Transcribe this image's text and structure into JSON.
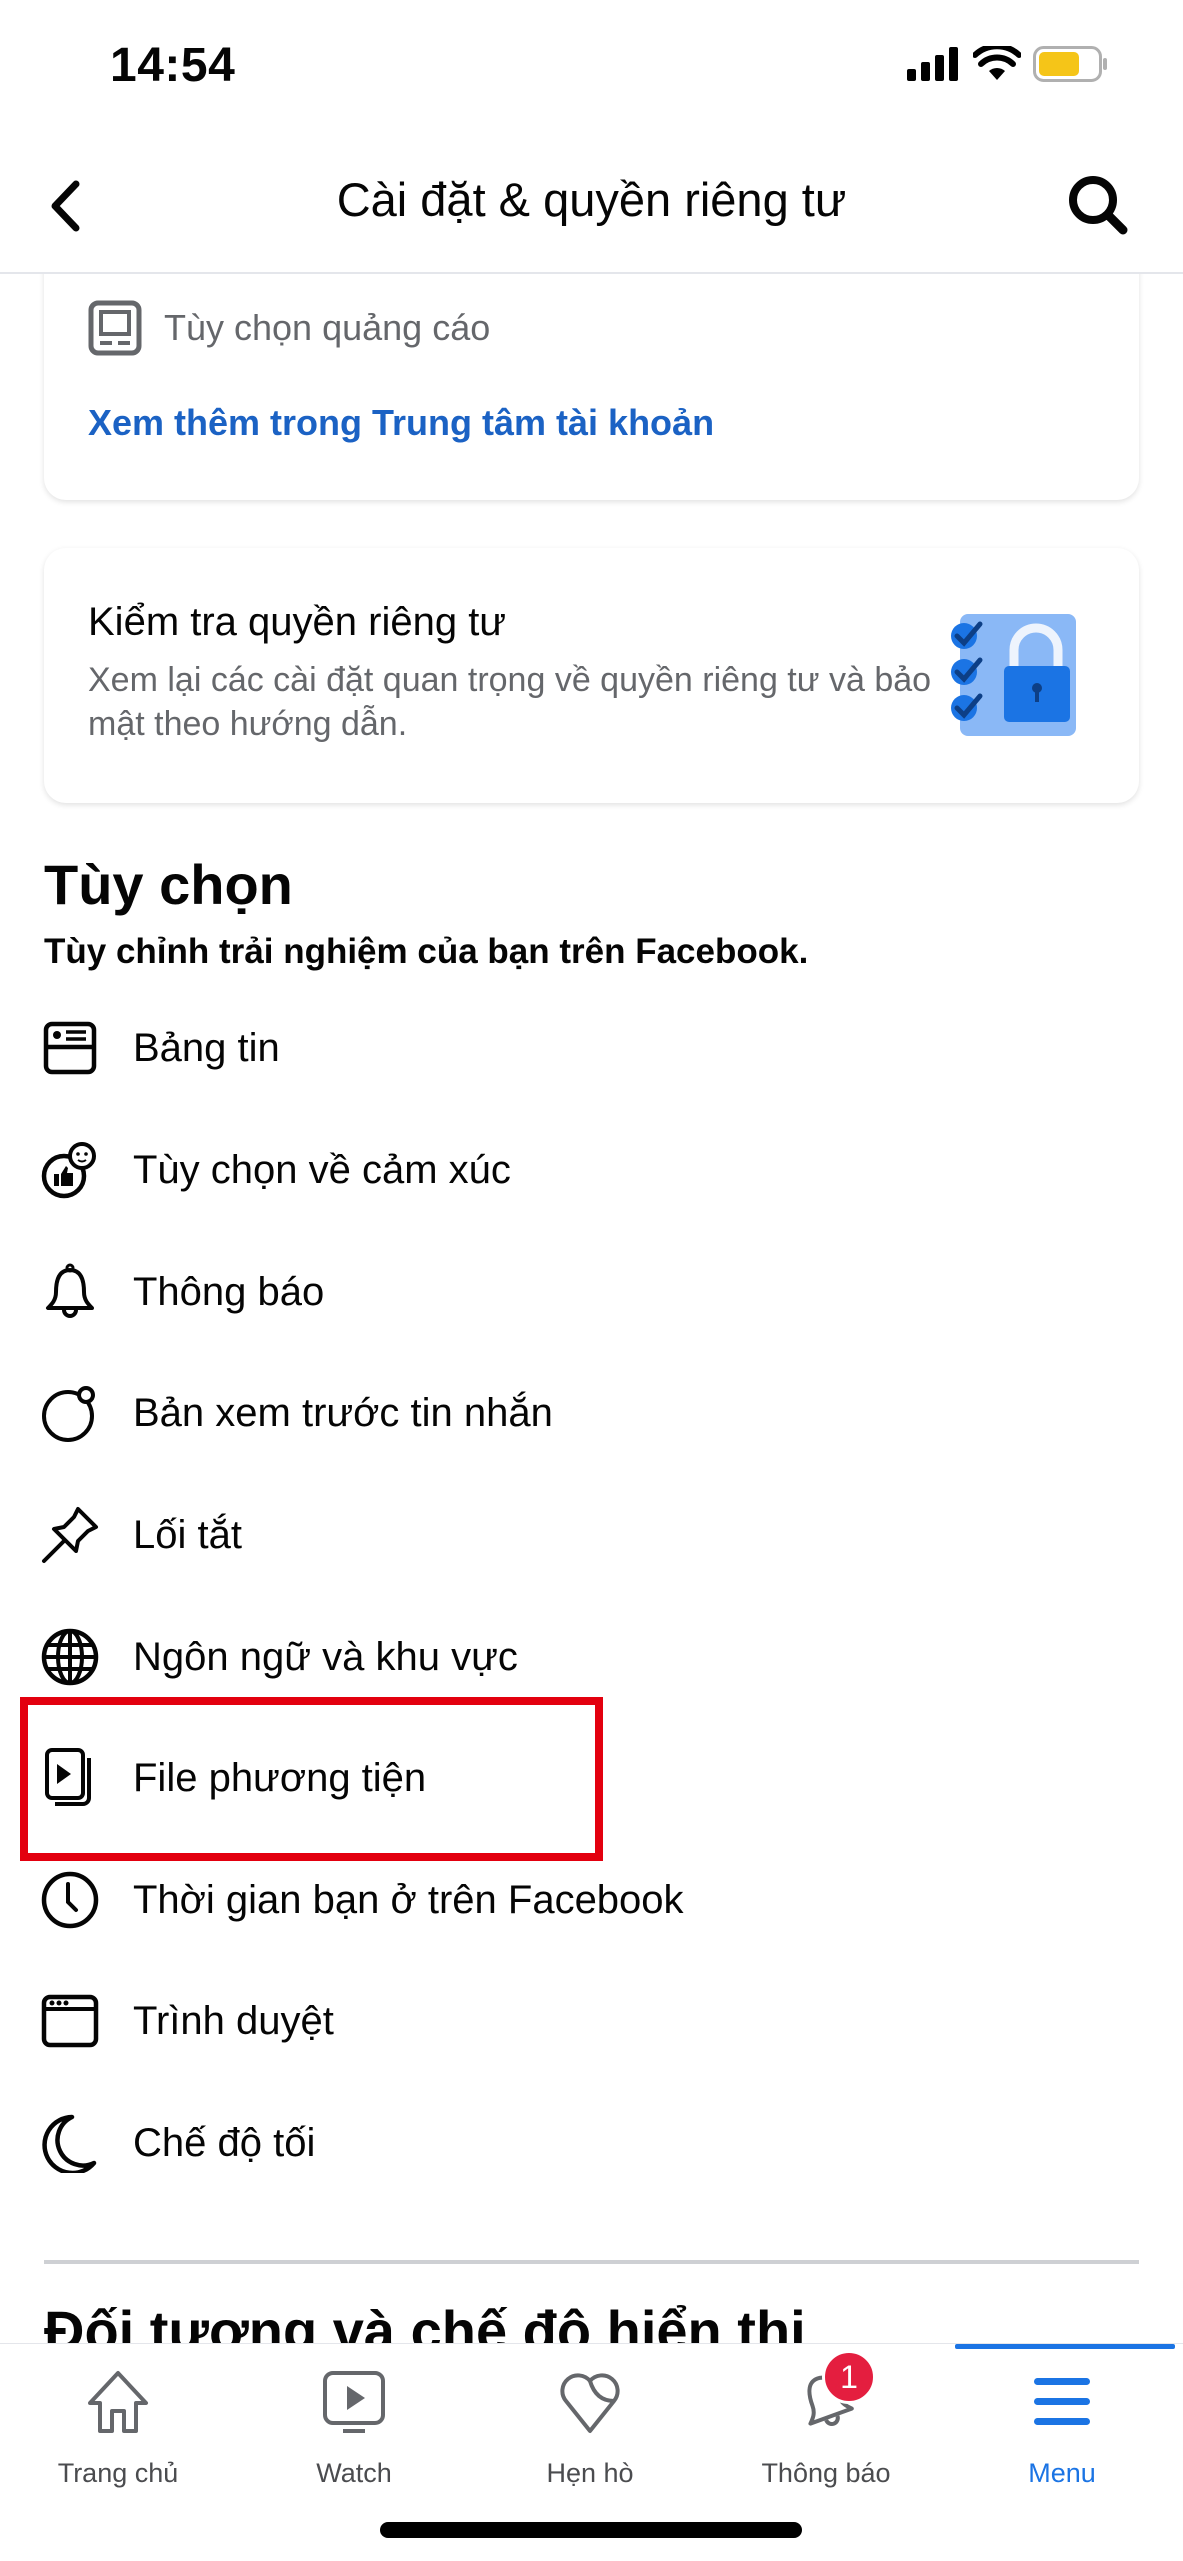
{
  "status_bar": {
    "time": "14:54",
    "battery_color": "#f5c518"
  },
  "header": {
    "title": "Cài đặt & quyền riêng tư"
  },
  "accounts_card": {
    "ads_preferences_label": "Tùy chọn quảng cáo",
    "link": "Xem thêm trong Trung tâm tài khoản"
  },
  "privacy_checkup": {
    "title": "Kiểm tra quyền riêng tư",
    "description": "Xem lại các cài đặt quan trọng về quyền riêng tư và bảo mật theo hướng dẫn."
  },
  "preferences": {
    "title": "Tùy chọn",
    "subtitle": "Tùy chỉnh trải nghiệm của bạn trên Facebook.",
    "items": [
      {
        "label": "Bảng tin",
        "icon": "news-feed-icon"
      },
      {
        "label": "Tùy chọn về cảm xúc",
        "icon": "reaction-icon"
      },
      {
        "label": "Thông báo",
        "icon": "bell-icon"
      },
      {
        "label": "Bản xem trước tin nhắn",
        "icon": "message-preview-icon"
      },
      {
        "label": "Lối tắt",
        "icon": "pin-icon"
      },
      {
        "label": "Ngôn ngữ và khu vực",
        "icon": "globe-icon"
      },
      {
        "label": "File phương tiện",
        "icon": "media-icon",
        "highlighted": true
      },
      {
        "label": "Thời gian bạn ở trên Facebook",
        "icon": "clock-icon"
      },
      {
        "label": "Trình duyệt",
        "icon": "browser-icon"
      },
      {
        "label": "Chế độ tối",
        "icon": "moon-icon"
      }
    ]
  },
  "next_section": {
    "title": "Đối tượng và chế độ hiển thị"
  },
  "tab_bar": {
    "active": "Menu",
    "accent_color": "#1b74e4",
    "tabs": [
      {
        "label": "Trang chủ",
        "icon": "home-icon"
      },
      {
        "label": "Watch",
        "icon": "watch-icon"
      },
      {
        "label": "Hẹn hò",
        "icon": "dating-heart-icon"
      },
      {
        "label": "Thông báo",
        "icon": "bell-icon",
        "badge": "1"
      },
      {
        "label": "Menu",
        "icon": "menu-icon"
      }
    ]
  },
  "highlight_color": "#e3000f"
}
